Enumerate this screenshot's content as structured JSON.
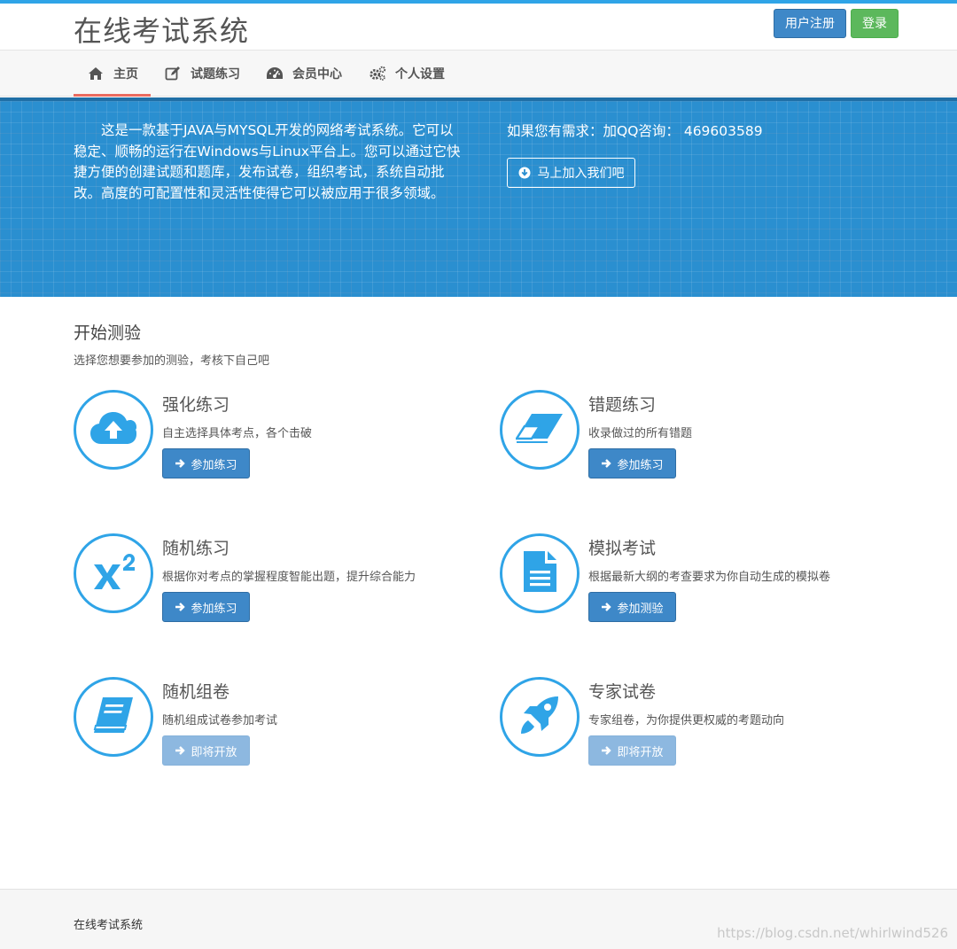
{
  "header": {
    "title": "在线考试系统",
    "register_label": "用户注册",
    "login_label": "登录"
  },
  "nav": {
    "items": [
      {
        "label": "主页",
        "icon": "home-icon"
      },
      {
        "label": "试题练习",
        "icon": "edit-icon"
      },
      {
        "label": "会员中心",
        "icon": "dashboard-icon"
      },
      {
        "label": "个人设置",
        "icon": "gears-icon"
      }
    ],
    "active_index": 0
  },
  "banner": {
    "intro": "这是一款基于JAVA与MYSQL开发的网络考试系统。它可以稳定、顺畅的运行在Windows与Linux平台上。您可以通过它快捷方便的创建试题和题库，发布试卷，组织考试，系统自动批改。高度的可配置性和灵活性使得它可以被应用于很多领域。",
    "contact": "如果您有需求：加QQ咨询： 469603589",
    "join_label": "马上加入我们吧"
  },
  "main": {
    "title": "开始测验",
    "subtitle": "选择您想要参加的测验，考核下自己吧",
    "cards": [
      {
        "title": "强化练习",
        "desc": "自主选择具体考点，各个击破",
        "action": "参加练习",
        "icon": "cloud-upload-icon",
        "enabled": true
      },
      {
        "title": "错题练习",
        "desc": "收录做过的所有错题",
        "action": "参加练习",
        "icon": "eraser-icon",
        "enabled": true
      },
      {
        "title": "随机练习",
        "desc": "根据你对考点的掌握程度智能出题，提升综合能力",
        "action": "参加练习",
        "icon": "superscript-icon",
        "enabled": true
      },
      {
        "title": "模拟考试",
        "desc": "根据最新大纲的考查要求为你自动生成的模拟卷",
        "action": "参加测验",
        "icon": "document-icon",
        "enabled": true
      },
      {
        "title": "随机组卷",
        "desc": "随机组成试卷参加考试",
        "action": "即将开放",
        "icon": "book-icon",
        "enabled": false
      },
      {
        "title": "专家试卷",
        "desc": "专家组卷，为你提供更权威的考题动向",
        "action": "即将开放",
        "icon": "rocket-icon",
        "enabled": false
      }
    ]
  },
  "footer": {
    "text": "在线考试系统"
  },
  "watermark": "https://blog.csdn.net/whirlwind526",
  "colors": {
    "accent": "#2fa4e7",
    "primary_button": "#3e88c8",
    "success_button": "#5cb85c",
    "disabled_button": "#8db8e0",
    "nav_active_underline": "#e96b5f",
    "banner_bg": "#2a8fd0"
  }
}
